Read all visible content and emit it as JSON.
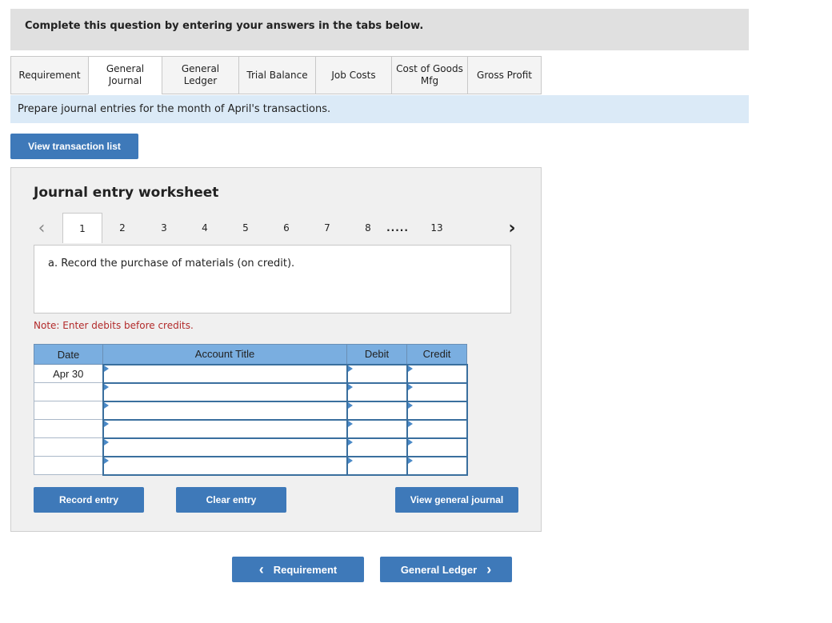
{
  "header": {
    "title": "Complete this question by entering your answers in the tabs below."
  },
  "tabs": [
    {
      "label": "Requirement",
      "active": false
    },
    {
      "label": "General\nJournal",
      "active": true
    },
    {
      "label": "General\nLedger",
      "active": false
    },
    {
      "label": "Trial Balance",
      "active": false
    },
    {
      "label": "Job Costs",
      "active": false
    },
    {
      "label": "Cost of Goods\nMfg",
      "active": false
    },
    {
      "label": "Gross Profit",
      "active": false
    }
  ],
  "instruction": "Prepare journal entries for the month of April's transactions.",
  "view_transaction_list": "View transaction list",
  "worksheet": {
    "title": "Journal entry worksheet",
    "pager": {
      "prev_icon": "‹",
      "next_icon": "›",
      "pages": [
        "1",
        "2",
        "3",
        "4",
        "5",
        "6",
        "7",
        "8",
        ".....",
        "13"
      ],
      "active_page": "1"
    },
    "description": "a. Record the purchase of materials (on credit).",
    "note": "Note: Enter debits before credits.",
    "table": {
      "headers": {
        "date": "Date",
        "account": "Account Title",
        "debit": "Debit",
        "credit": "Credit"
      },
      "rows": [
        {
          "date": "Apr 30",
          "account": "",
          "debit": "",
          "credit": ""
        },
        {
          "date": "",
          "account": "",
          "debit": "",
          "credit": ""
        },
        {
          "date": "",
          "account": "",
          "debit": "",
          "credit": ""
        },
        {
          "date": "",
          "account": "",
          "debit": "",
          "credit": ""
        },
        {
          "date": "",
          "account": "",
          "debit": "",
          "credit": ""
        },
        {
          "date": "",
          "account": "",
          "debit": "",
          "credit": ""
        }
      ]
    },
    "buttons": {
      "record": "Record entry",
      "clear": "Clear entry",
      "view_journal": "View general journal"
    }
  },
  "nav": {
    "prev_label": "Requirement",
    "prev_icon": "‹",
    "next_label": "General Ledger",
    "next_icon": "›"
  },
  "colors": {
    "accent": "#3e79b9",
    "table_header": "#7aaee0",
    "note": "#b22a2a",
    "instruction_bg": "#dbeaf7"
  }
}
